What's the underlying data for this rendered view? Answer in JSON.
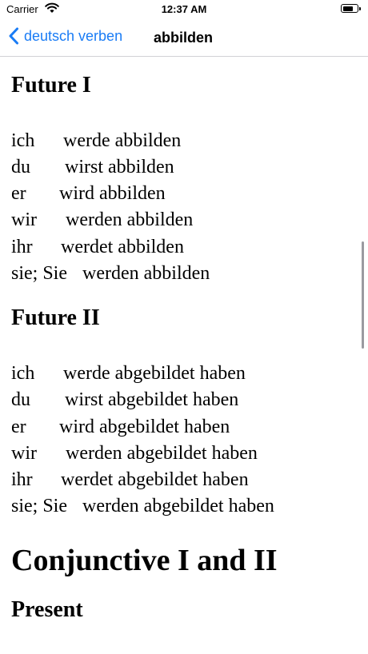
{
  "status_bar": {
    "carrier": "Carrier",
    "time": "12:37 AM",
    "battery_level": 0.8
  },
  "nav": {
    "back_label": "deutsch verben",
    "title": "abbilden",
    "accent": "#1a7cf5"
  },
  "sections": [
    {
      "heading": "Future I",
      "rows": [
        {
          "pronoun": "ich",
          "form": "werde abbilden"
        },
        {
          "pronoun": "du",
          "form": "wirst abbilden"
        },
        {
          "pronoun": "er",
          "form": "wird abbilden"
        },
        {
          "pronoun": "wir",
          "form": "werden abbilden"
        },
        {
          "pronoun": "ihr",
          "form": "werdet abbilden"
        },
        {
          "pronoun": "sie; Sie",
          "form": "werden abbilden"
        }
      ]
    },
    {
      "heading": "Future II",
      "rows": [
        {
          "pronoun": "ich",
          "form": "werde abgebildet haben"
        },
        {
          "pronoun": "du",
          "form": "wirst abgebildet haben"
        },
        {
          "pronoun": "er",
          "form": "wird abgebildet haben"
        },
        {
          "pronoun": "wir",
          "form": "werden abgebildet haben"
        },
        {
          "pronoun": "ihr",
          "form": "werdet abgebildet haben"
        },
        {
          "pronoun": "sie; Sie",
          "form": "werden abgebildet haben"
        }
      ]
    }
  ],
  "mood_heading": "Conjunctive I and II",
  "next_heading": "Present"
}
